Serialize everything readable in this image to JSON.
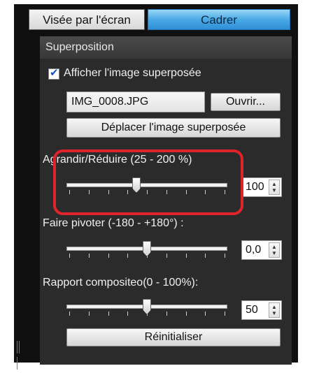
{
  "tabs": {
    "live_view": "Visée par l'écran",
    "frame": "Cadrer"
  },
  "panel": {
    "title": "Superposition"
  },
  "overlay": {
    "show_label": "Afficher l'image superposée",
    "show_checked": true,
    "filename": "IMG_0008.JPG",
    "open_button": "Ouvrir...",
    "move_button": "Déplacer l'image superposée"
  },
  "zoom": {
    "label": "Agrandir/Réduire (25 - 200 %)",
    "value": "100",
    "level": 0.43
  },
  "rotate": {
    "label": "Faire pivoter (-180 - +180°) :",
    "value": "0,0",
    "level": 0.5
  },
  "composite": {
    "label": "Rapport compositeo(0 - 100%):",
    "value": "50",
    "level": 0.5
  },
  "reset_button": "Réinitialiser",
  "colors": {
    "accent_tab": "#4aa9e6",
    "highlight": "#e0232a",
    "panel": "#2b2b2b"
  }
}
